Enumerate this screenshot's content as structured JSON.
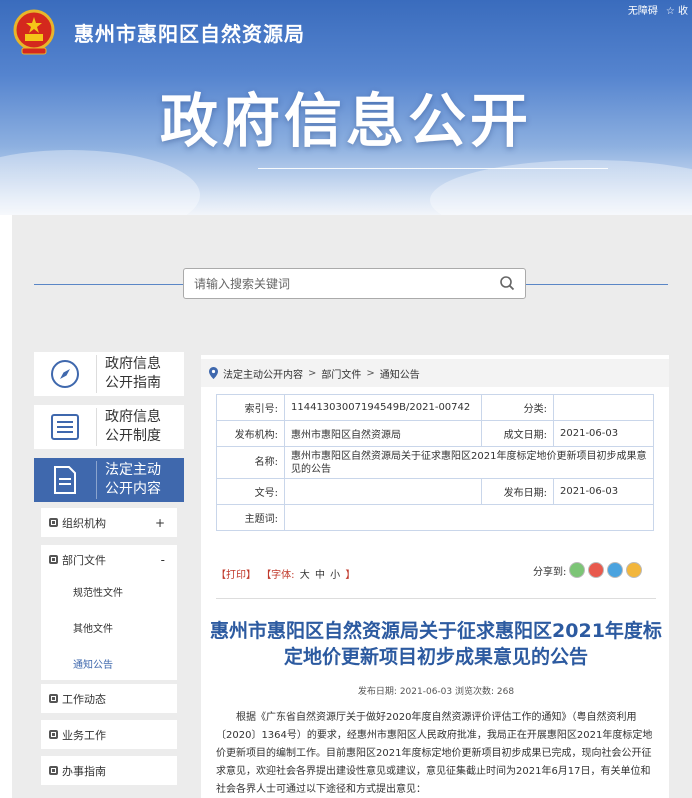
{
  "header": {
    "site_name": "惠州市惠阳区自然资源局",
    "page_title": "政府信息公开",
    "accessibility_label": "无障碍",
    "favorite_label": "收"
  },
  "search": {
    "placeholder": "请输入搜索关键词"
  },
  "sidebar": {
    "cards": [
      {
        "line1": "政府信息",
        "line2": "公开指南",
        "icon": "compass-icon"
      },
      {
        "line1": "政府信息",
        "line2": "公开制度",
        "icon": "list-icon"
      },
      {
        "line1": "法定主动",
        "line2": "公开内容",
        "icon": "document-icon",
        "active": true
      }
    ],
    "items": [
      {
        "label": "组织机构",
        "sign": "+"
      },
      {
        "label": "部门文件",
        "sign": "-"
      },
      {
        "label": "工作动态"
      },
      {
        "label": "业务工作"
      },
      {
        "label": "办事指南"
      }
    ],
    "sub_items": [
      "规范性文件",
      "其他文件",
      "通知公告"
    ]
  },
  "breadcrumb": [
    "法定主动公开内容",
    "部门文件",
    "通知公告"
  ],
  "meta": {
    "index_label": "索引号:",
    "index_value": "11441303007194549B/2021-00742",
    "category_label": "分类:",
    "category_value": "",
    "publisher_label": "发布机构:",
    "publisher_value": "惠州市惠阳区自然资源局",
    "created_label": "成文日期:",
    "created_value": "2021-06-03",
    "name_label": "名称:",
    "name_value": "惠州市惠阳区自然资源局关于征求惠阳区2021年度标定地价更新项目初步成果意见的公告",
    "docno_label": "文号:",
    "docno_value": "",
    "pubdate_label": "发布日期:",
    "pubdate_value": "2021-06-03",
    "subject_label": "主题词:",
    "subject_value": ""
  },
  "tools": {
    "print": "【打印】",
    "font_label": "【字体:",
    "large": "大",
    "medium": "中",
    "small": "小",
    "close_bracket": "】",
    "share_label": "分享到:"
  },
  "article": {
    "title": "惠州市惠阳区自然资源局关于征求惠阳区2021年度标定地价更新项目初步成果意见的公告",
    "publish_info": "发布日期: 2021-06-03   浏览次数: 268",
    "body": "根据《广东省自然资源厅关于做好2020年度自然资源评价评估工作的通知》（粤自然资利用〔2020〕1364号）的要求，经惠州市惠阳区人民政府批准，我局正在开展惠阳区2021年度标定地价更新项目的编制工作。目前惠阳区2021年度标定地价更新项目初步成果已完成，现向社会公开征求意见，欢迎社会各界提出建设性意见或建议，意见征集截止时间为2021年6月17日，有关单位和社会各界人士可通过以下途径和方式提出意见："
  }
}
